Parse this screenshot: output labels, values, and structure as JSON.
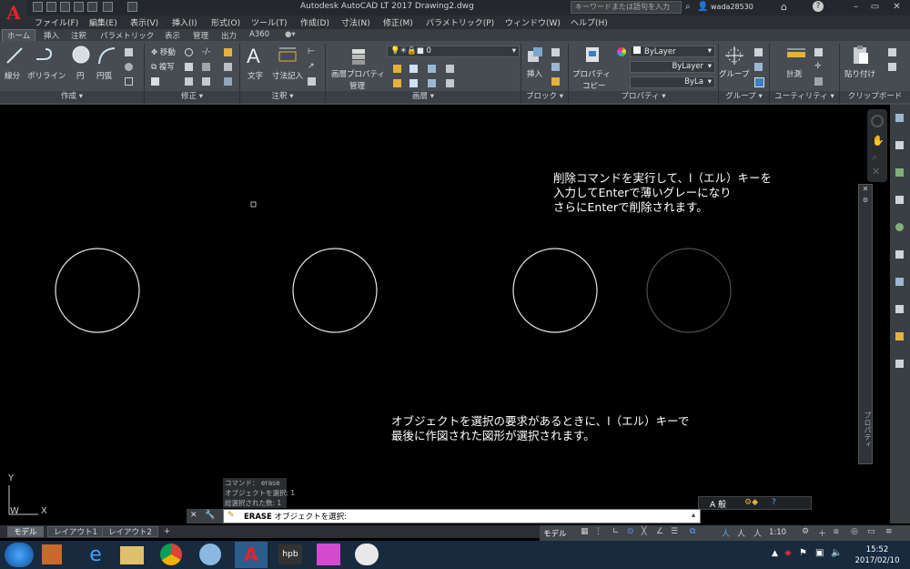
{
  "titlebar": {
    "app_title": "Autodesk AutoCAD LT 2017    Drawing2.dwg",
    "search_placeholder": "キーワードまたは語句を入力",
    "user": "wada28530",
    "app_badge": "A",
    "app_badge_sub": "LT"
  },
  "menu": [
    "ファイル(F)",
    "編集(E)",
    "表示(V)",
    "挿入(I)",
    "形式(O)",
    "ツール(T)",
    "作成(D)",
    "寸法(N)",
    "修正(M)",
    "パラメトリック(P)",
    "ウィンドウ(W)",
    "ヘルプ(H)"
  ],
  "ribbon_tabs": [
    "ホーム",
    "挿入",
    "注釈",
    "パラメトリック",
    "表示",
    "管理",
    "出力",
    "A360"
  ],
  "ribbon": {
    "draw": {
      "line": "線分",
      "polyline": "ポリライン",
      "circle": "円",
      "arc": "円弧"
    },
    "modify": {
      "move": "移動",
      "copy": "複写"
    },
    "annotation": {
      "text": "文字",
      "dimension": "寸法記入"
    },
    "layers": {
      "properties": "画層プロパティ",
      "manage": "管理",
      "current_layer": "0"
    },
    "block": {
      "insert": "挿入"
    },
    "properties": {
      "label": "プロパティ",
      "copy": "コピー",
      "color": "ByLayer",
      "linetype": "ByLayer",
      "lineweight": "ByLa"
    },
    "groups": {
      "group": "グループ"
    },
    "utilities": {
      "measure": "計測"
    },
    "clipboard": {
      "paste": "貼り付け"
    },
    "panel_titles": [
      "作成 ▾",
      "修正 ▾",
      "注釈 ▾",
      "画層 ▾",
      "ブロック ▾",
      "プロパティ ▾",
      "グループ ▾",
      "ユーティリティ ▾",
      "クリップボード"
    ]
  },
  "canvas": {
    "note_top": [
      "削除コマンドを実行して、l（エル）キーを",
      "入力してEnterで薄いグレーになり",
      "さらにEnterで削除されます。"
    ],
    "note_bottom": [
      "オブジェクトを選択の要求があるときに、l（エル）キーで",
      "最後に作図された図形が選択されます。"
    ],
    "circles": [
      "white",
      "white",
      "white",
      "gray"
    ],
    "ucs": {
      "x": "X",
      "y": "Y",
      "w": "W"
    },
    "palette_label": "プロパティ"
  },
  "command_line": {
    "history": [
      "コマンド： erase",
      "オブジェクトを選択: 1",
      "総選択された数: 1"
    ],
    "command": "ERASE",
    "prompt": "オブジェクトを選択:",
    "ime": "A 般"
  },
  "layout_tabs": [
    "モデル",
    "レイアウト1",
    "レイアウト2",
    "+"
  ],
  "statusbar": {
    "model": "モデル",
    "scale": "1:10"
  },
  "taskbar": {
    "time": "15:52",
    "date": "2017/02/10"
  }
}
